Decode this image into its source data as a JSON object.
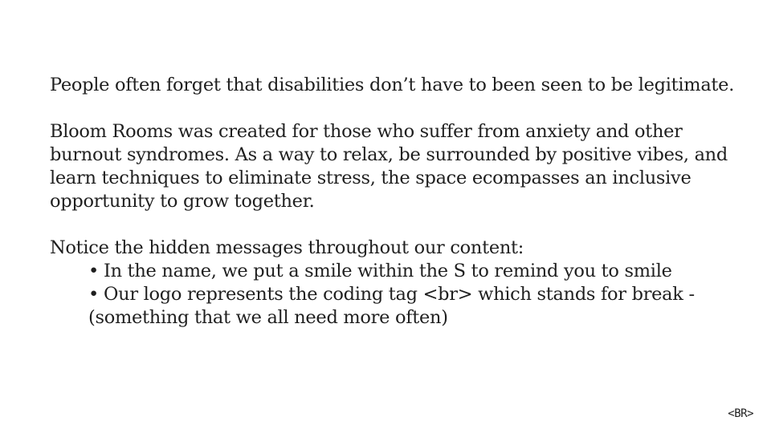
{
  "paragraphs": {
    "p1": "People often forget that disabilities don’t have to been seen to be legitimate.",
    "p2": "Bloom Rooms was created for those who suffer from anxiety and other burnout syndromes. As a way to relax, be surrounded by positive vibes, and learn techniques to eliminate stress, the space ecompasses an inclusive opportunity to grow together.",
    "p3_intro": "Notice the hidden messages throughout our content:"
  },
  "bullets": {
    "marker": "•",
    "items": [
      "In the name, we put a smile within the S to remind you to smile",
      "Our logo represents the coding tag <br> which stands for break - (something that we all need more often)"
    ]
  },
  "logo": {
    "text": "<BR>"
  }
}
